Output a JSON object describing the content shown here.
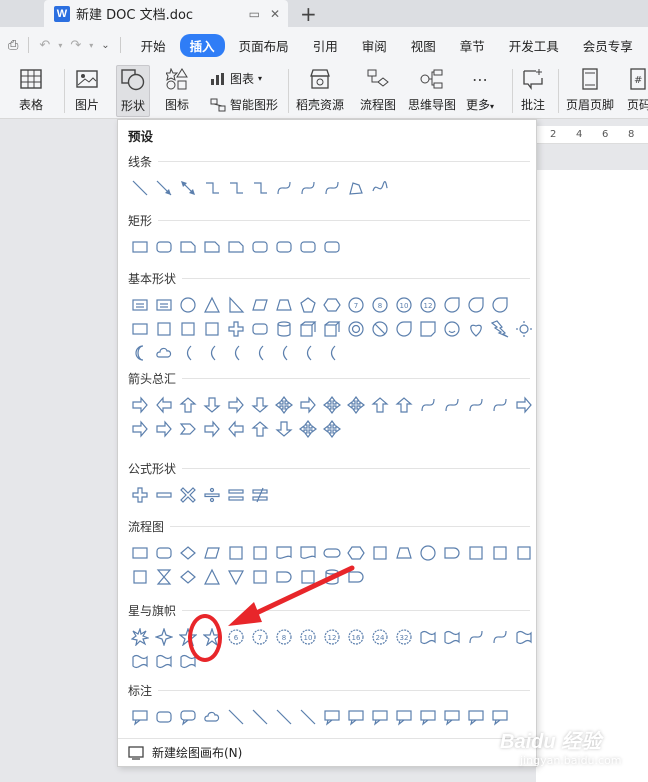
{
  "titlebar": {
    "doc_name": "新建 DOC 文档.doc",
    "logo_letter": "W"
  },
  "menubar": {
    "items": [
      "开始",
      "插入",
      "页面布局",
      "引用",
      "审阅",
      "视图",
      "章节",
      "开发工具",
      "会员专享"
    ],
    "active": "插入"
  },
  "ribbon": {
    "table": "表格",
    "picture": "图片",
    "shape": "形状",
    "icon": "图标",
    "chart": "图表",
    "smart": "智能图形",
    "straw": "稻壳资源",
    "flow": "流程图",
    "mind": "思维导图",
    "more": "更多",
    "comment": "批注",
    "header": "页眉页脚",
    "pagenum": "页码"
  },
  "ruler": {
    "marks": [
      "2",
      "4",
      "6",
      "8"
    ]
  },
  "panel": {
    "preset": "预设",
    "categories": [
      {
        "title": "线条",
        "shapes": [
          [
            "line",
            "arrow-line",
            "double-arrow",
            "elbow",
            "elbow-arrow",
            "elbow-double",
            "curve",
            "curve-arrow",
            "curve-double",
            "freeform",
            "scribble"
          ]
        ]
      },
      {
        "title": "矩形",
        "shapes": [
          [
            "rect",
            "round-rect",
            "snip-rect",
            "snip2-rect",
            "snip-diag-rect",
            "snip-round-rect",
            "round1-rect",
            "round2-rect",
            "round-diag-rect"
          ]
        ]
      },
      {
        "title": "基本形状",
        "shapes": [
          [
            "textbox",
            "vertical-textbox",
            "ellipse",
            "triangle",
            "right-triangle",
            "parallelogram",
            "trapezoid",
            "pentagon",
            "hexagon",
            "heptagon",
            "octagon",
            "decagon",
            "dodecagon",
            "pie",
            "chord",
            "teardrop"
          ],
          [
            "frame",
            "half-frame",
            "l-shape",
            "diagonal-stripe",
            "cross",
            "plaque",
            "can",
            "cube",
            "bevel",
            "donut",
            "no-symbol",
            "block-arc",
            "folded-corner",
            "smiley",
            "heart",
            "lightning",
            "sun"
          ],
          [
            "moon",
            "cloud",
            "arc",
            "double-bracket",
            "double-brace",
            "left-bracket",
            "right-bracket",
            "left-brace",
            "right-brace"
          ]
        ]
      },
      {
        "title": "箭头总汇",
        "shapes": [
          [
            "right-arrow",
            "left-arrow",
            "up-arrow",
            "down-arrow",
            "left-right-arrow",
            "up-down-arrow",
            "quad-arrow",
            "left-right-up-arrow",
            "bent-arrow",
            "u-turn-arrow",
            "left-up-arrow",
            "bent-up-arrow",
            "curved-right-arrow",
            "curved-left-arrow",
            "curved-up-arrow",
            "curved-down-arrow",
            "striped-right-arrow"
          ],
          [
            "notched-right-arrow",
            "pentagon-arrow",
            "chevron",
            "right-arrow-callout",
            "left-arrow-callout",
            "up-arrow-callout",
            "down-arrow-callout",
            "quad-arrow-callout",
            "circular-arrow"
          ]
        ]
      },
      {
        "title": "公式形状",
        "shapes": [
          [
            "plus",
            "minus",
            "multiply",
            "divide",
            "equal",
            "not-equal"
          ]
        ]
      },
      {
        "title": "流程图",
        "shapes": [
          [
            "process",
            "alternate-process",
            "decision",
            "data",
            "predefined-process",
            "internal-storage",
            "document",
            "multidocument",
            "terminator",
            "preparation",
            "manual-input",
            "manual-operation",
            "connector",
            "offpage-connector",
            "punched-card",
            "punched-tape",
            "summing-junction"
          ],
          [
            "or",
            "collate",
            "sort",
            "extract",
            "merge",
            "stored-data",
            "delay",
            "sequential-storage",
            "magnetic-disk",
            "display"
          ]
        ]
      },
      {
        "title": "星与旗帜",
        "shapes": [
          [
            "explosion1",
            "star4",
            "star5-small",
            "star5",
            "star6",
            "star7",
            "star8",
            "star10",
            "star12",
            "star16",
            "star24",
            "star32",
            "ribbon-up",
            "ribbon-down",
            "curved-ribbon-up",
            "curved-ribbon-down",
            "vertical-scroll"
          ],
          [
            "horizontal-scroll",
            "wave",
            "double-wave"
          ]
        ]
      },
      {
        "title": "标注",
        "shapes": [
          [
            "rect-callout",
            "round-rect-callout",
            "oval-callout",
            "cloud-callout",
            "line-callout1",
            "line-callout2",
            "line-callout3",
            "line-callout4",
            "accent-callout1",
            "accent-callout2",
            "accent-callout3",
            "accent-callout4",
            "border-callout1",
            "border-callout2",
            "border-callout3",
            "border-callout4"
          ]
        ]
      }
    ],
    "new_canvas": "新建绘图画布(N)"
  },
  "watermark": {
    "brand": "Baidu 经验",
    "site": "jingyan.baidu.com"
  },
  "colors": {
    "accent": "#2f7df6",
    "shape_stroke": "#5b7fad",
    "annotation": "#e8262a"
  }
}
